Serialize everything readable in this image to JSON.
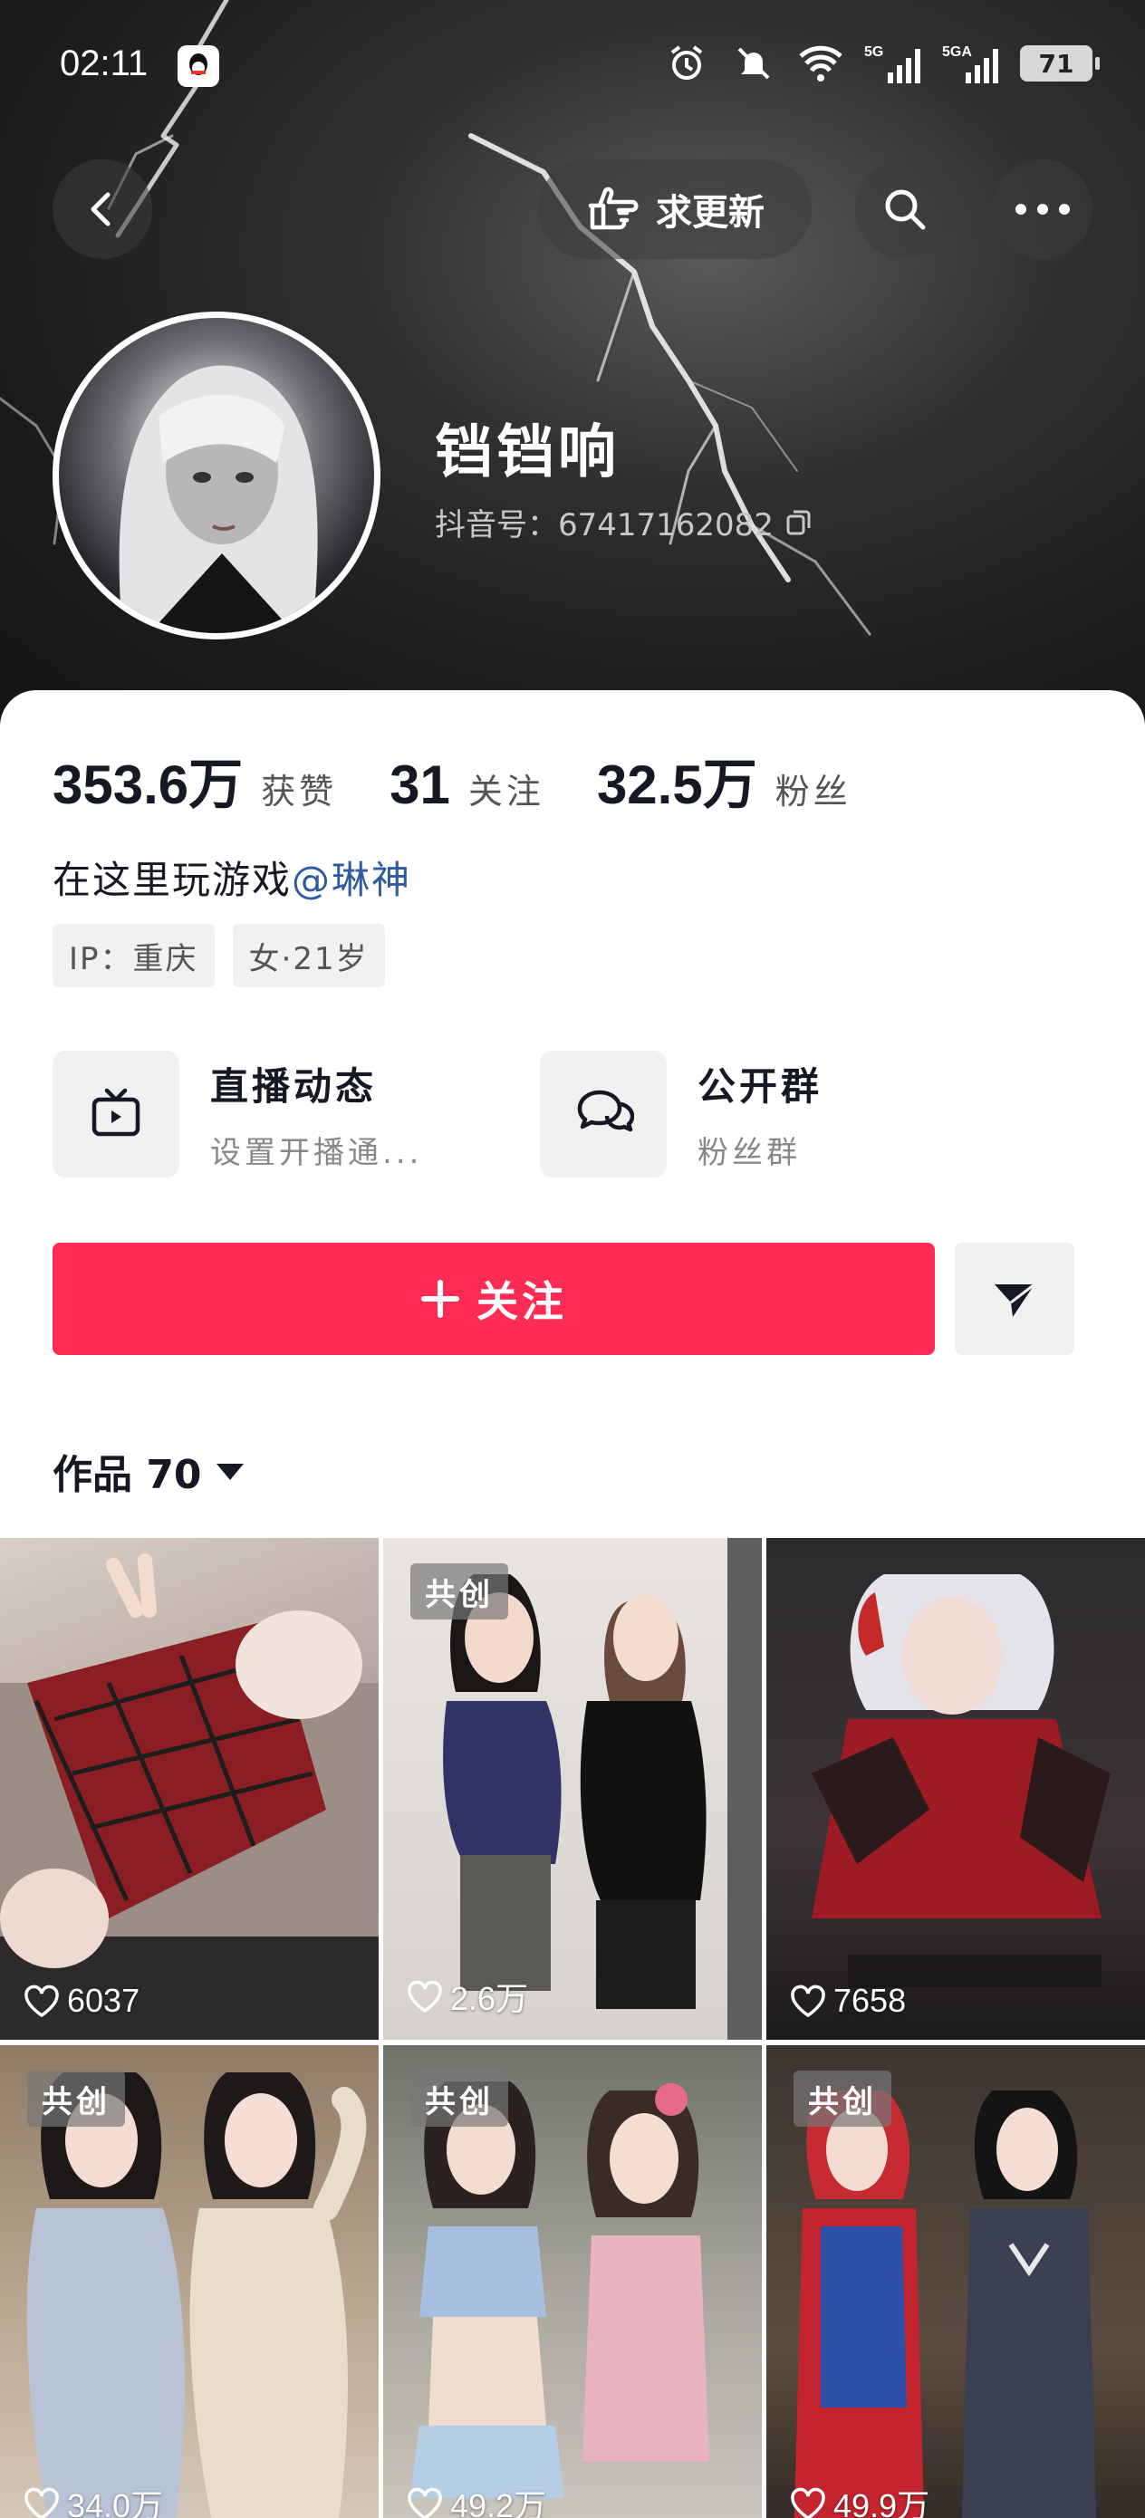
{
  "status_bar": {
    "time": "02:11",
    "network_1": "5G",
    "network_2": "5GA",
    "battery": "71"
  },
  "nav": {
    "request_update_label": "求更新"
  },
  "profile": {
    "name": "铛铛响",
    "douyin_id": "抖音号：67417162082",
    "stats": [
      {
        "value": "353.6万",
        "label": "获赞"
      },
      {
        "value": "31",
        "label": "关注"
      },
      {
        "value": "32.5万",
        "label": "粉丝"
      }
    ],
    "bio_text": "在这里玩游戏",
    "bio_mention": "@琳神",
    "tags": [
      "IP：重庆",
      "女·21岁"
    ]
  },
  "features": [
    {
      "title": "直播动态",
      "subtitle": "设置开播通..."
    },
    {
      "title": "公开群",
      "subtitle": "粉丝群"
    }
  ],
  "actions": {
    "follow_label": "关注"
  },
  "works": {
    "tab_label": "作品 70",
    "items": [
      {
        "likes": "6037",
        "cocreate": ""
      },
      {
        "likes": "2.6万",
        "cocreate": "共创"
      },
      {
        "likes": "7658",
        "cocreate": ""
      },
      {
        "likes": "34.0万",
        "cocreate": "共创"
      },
      {
        "likes": "49.2万",
        "cocreate": "共创"
      },
      {
        "likes": "49.9万",
        "cocreate": "共创"
      }
    ]
  },
  "colors": {
    "accent": "#fe2c55",
    "mention": "#2f5a9e",
    "banner": "#1c1c1c"
  }
}
